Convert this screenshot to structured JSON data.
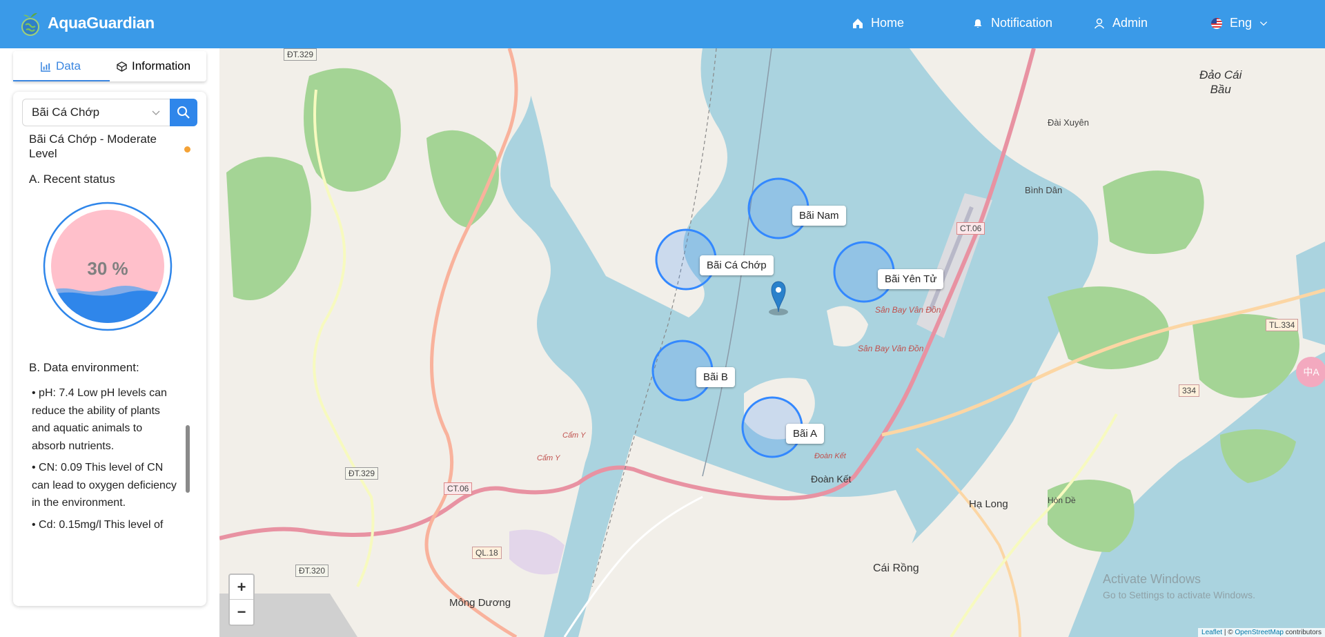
{
  "header": {
    "brand": "AquaGuardian",
    "nav": {
      "home": "Home",
      "notification": "Notification",
      "admin": "Admin",
      "language": "Eng"
    }
  },
  "sidebar": {
    "tabs": [
      {
        "label": "Data",
        "icon": "chart-icon",
        "active": true
      },
      {
        "label": "Information",
        "icon": "cube-icon",
        "active": false
      }
    ],
    "search": {
      "value": "Bãi Cá Chớp"
    },
    "site_title": "Bãi Cá Chớp - Moderate Level",
    "level_color": "#f4a236",
    "section_a": "A. Recent status",
    "gauge": {
      "value": 30,
      "label": "30 %"
    },
    "section_b": "B. Data environment:",
    "env_items": [
      "• pH: 7.4 Low pH levels can reduce the ability of plants and aquatic animals to absorb nutrients.",
      "• CN: 0.09 This level of CN can lead to oxygen deficiency in the environment.",
      "• Cd: 0.15mg/l This level of"
    ]
  },
  "map": {
    "sites": [
      {
        "name": "Bãi Nam"
      },
      {
        "name": "Bãi Cá Chớp"
      },
      {
        "name": "Bãi Yên Tử"
      },
      {
        "name": "Bãi B"
      },
      {
        "name": "Bãi A"
      }
    ],
    "place_labels": [
      "Đảo Cái",
      "Bầu",
      "Đài Xuyên",
      "Bình Dân",
      "Sân Bay Vân Đồn",
      "Sân Bay Vân Đồn",
      "Đoàn Kết",
      "Đoàn Kết",
      "Hạ Long",
      "Hòn Dề",
      "Cái Rồng",
      "Mông Dương",
      "Cẩm Y",
      "Cẩm Y"
    ],
    "road_shields": [
      "ĐT.329",
      "CT.06",
      "TL.334",
      "334",
      "ĐT.329",
      "CT.06",
      "QL.18",
      "ĐT.320"
    ],
    "zoom_in": "+",
    "zoom_out": "−",
    "attribution": {
      "leaflet": "Leaflet",
      "osm": "OpenStreetMap",
      "suffix": "contributors"
    },
    "watermark": {
      "title": "Activate Windows",
      "subtitle": "Go to Settings to activate Windows."
    },
    "side_button": "中A"
  },
  "colors": {
    "header": "#3a9ae8",
    "accent": "#2f86ea",
    "water": "#aad3df",
    "land": "#f2efe9",
    "forest": "#a4d495",
    "gauge_fill": "#ffc0cb",
    "gauge_water": "#2f86ea"
  }
}
